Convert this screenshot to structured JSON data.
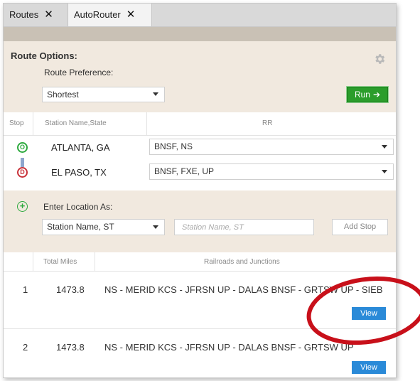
{
  "tabs": [
    {
      "label": "Routes",
      "close": "✕"
    },
    {
      "label": "AutoRouter",
      "close": "✕"
    }
  ],
  "route_options": {
    "title": "Route Options:",
    "preference_label": "Route Preference:",
    "preference_value": "Shortest",
    "run_label": "Run",
    "run_arrow": "➔"
  },
  "stops_table": {
    "headers": {
      "stop": "Stop",
      "station": "Station Name,State",
      "rr": "RR"
    },
    "rows": [
      {
        "badge": "O",
        "station": "ATLANTA, GA",
        "rr": "BNSF, NS"
      },
      {
        "badge": "D",
        "station": "EL PASO, TX",
        "rr": "BNSF, FXE, UP"
      }
    ]
  },
  "add_location": {
    "label": "Enter Location As:",
    "format_value": "Station Name, ST",
    "input_placeholder": "Station Name, ST",
    "add_button": "Add Stop"
  },
  "results": {
    "headers": {
      "miles": "Total Miles",
      "rails": "Railroads and Junctions"
    },
    "rows": [
      {
        "num": "1",
        "miles": "1473.8",
        "path": "NS - MERID KCS - JFRSN UP - DALAS BNSF - GRTSW UP - SIEB",
        "view": "View"
      },
      {
        "num": "2",
        "miles": "1473.8",
        "path": "NS - MERID KCS - JFRSN UP - DALAS BNSF - GRTSW UP",
        "view": "View"
      }
    ]
  },
  "colors": {
    "accent_green": "#2b9d2b",
    "view_blue": "#2a8ad8",
    "panel_bg": "#f1e9df",
    "annotation_red": "#c8101a"
  },
  "icons": {
    "settings": "gear-icon",
    "origin": "origin-badge-icon",
    "destination": "destination-badge-icon",
    "add": "plus-icon"
  }
}
